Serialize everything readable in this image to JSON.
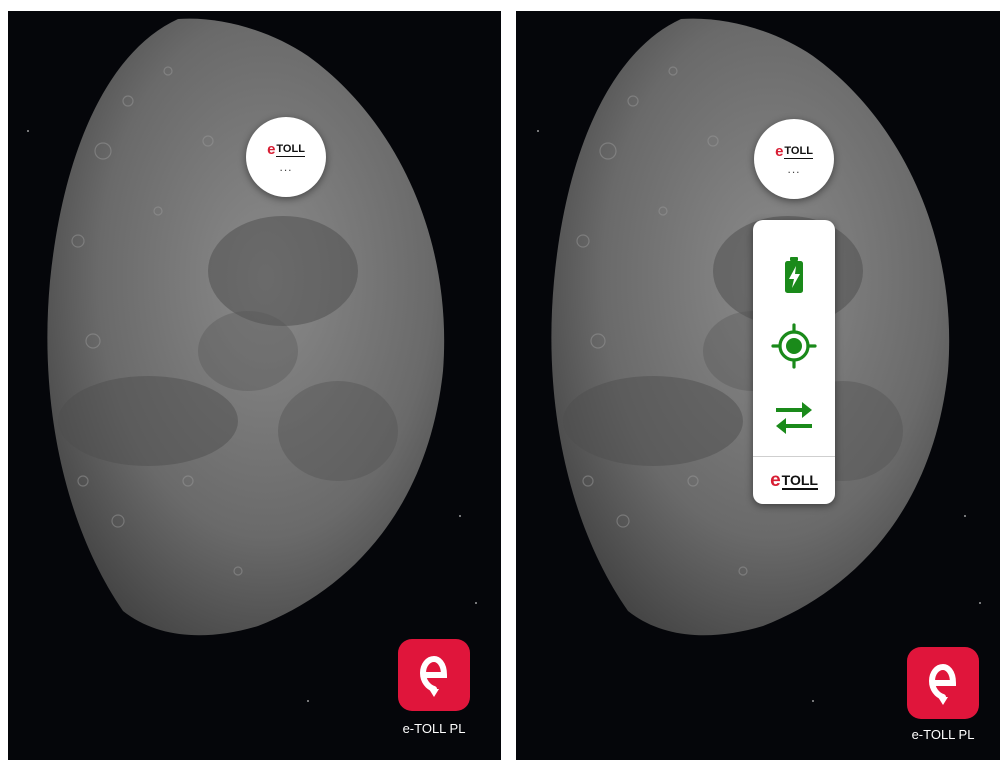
{
  "left_screen": {
    "bubble": {
      "logo_text": "TOLL",
      "more_indicator": "..."
    },
    "app_icon": {
      "label": "e-TOLL PL",
      "icon": "etoll-app-icon"
    }
  },
  "right_screen": {
    "bubble": {
      "logo_text": "TOLL",
      "more_indicator": "..."
    },
    "menu": {
      "items": [
        {
          "icon": "battery-charging-icon"
        },
        {
          "icon": "gps-target-icon"
        },
        {
          "icon": "swap-arrows-icon"
        }
      ],
      "footer_logo_text": "TOLL"
    },
    "app_icon": {
      "label": "e-TOLL PL",
      "icon": "etoll-app-icon"
    }
  },
  "colors": {
    "brand_red": "#e0153b",
    "logo_red": "#d81e34",
    "menu_icon_green": "#1a8a1a",
    "wallpaper": "#05060a"
  }
}
